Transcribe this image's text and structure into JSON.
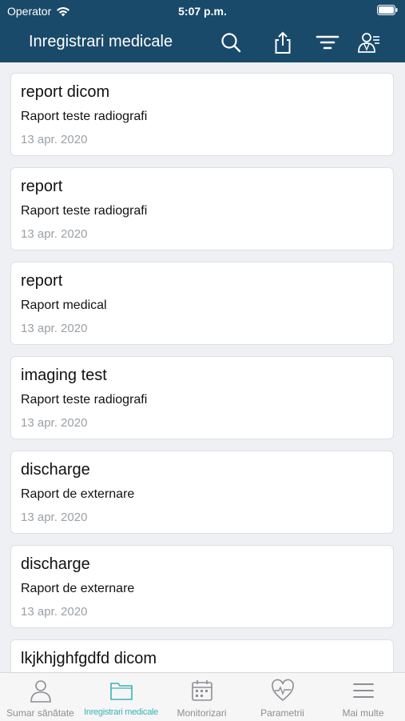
{
  "status_bar": {
    "carrier": "Operator",
    "time": "5:07 p.m."
  },
  "header": {
    "title": "Inregistrari medicale",
    "icons": [
      "search-icon",
      "share-icon",
      "filter-icon",
      "doctor-list-icon"
    ]
  },
  "records": [
    {
      "title": "report dicom",
      "subtitle": "Raport teste radiografi",
      "date": "13 apr. 2020"
    },
    {
      "title": "report",
      "subtitle": "Raport teste radiografi",
      "date": "13 apr. 2020"
    },
    {
      "title": "report",
      "subtitle": "Raport medical",
      "date": "13 apr. 2020"
    },
    {
      "title": "imaging test",
      "subtitle": "Raport teste radiografi",
      "date": "13 apr. 2020"
    },
    {
      "title": "discharge",
      "subtitle": "Raport de externare",
      "date": "13 apr. 2020"
    },
    {
      "title": "discharge",
      "subtitle": "Raport de externare",
      "date": "13 apr. 2020"
    },
    {
      "title": "lkjkhjghfgdfd dicom",
      "subtitle": "",
      "date": ""
    }
  ],
  "tabs": [
    {
      "label": "Sumar sănătate",
      "icon": "person-icon"
    },
    {
      "label": "Inregistrari medicale",
      "icon": "folder-icon",
      "active": true
    },
    {
      "label": "Monitorizari",
      "icon": "calendar-icon"
    },
    {
      "label": "Parametrii",
      "icon": "heart-pulse-icon"
    },
    {
      "label": "Mai multe",
      "icon": "menu-icon"
    }
  ],
  "colors": {
    "header_bg": "#1a4a6a",
    "accent": "#3cb3b3",
    "tab_inactive": "#8e8e93"
  }
}
